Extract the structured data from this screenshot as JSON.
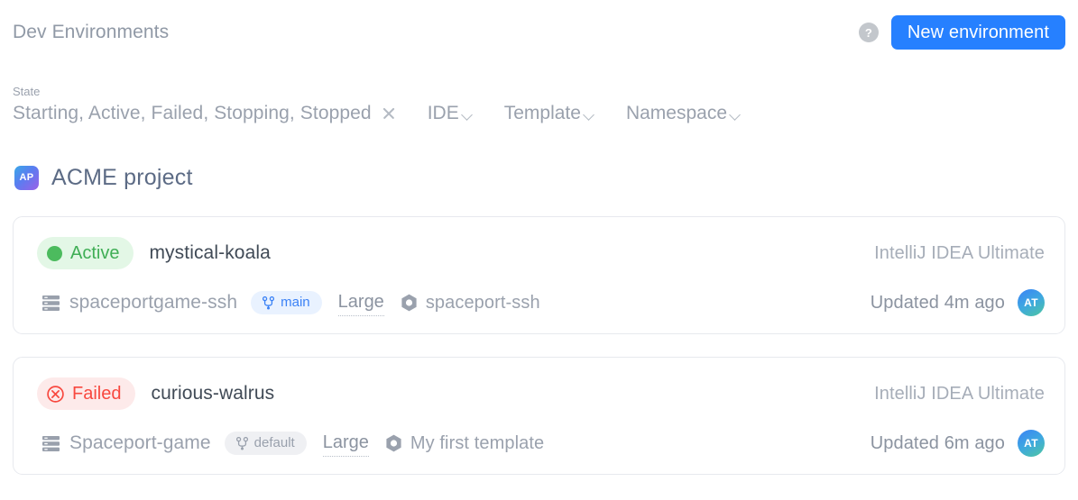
{
  "header": {
    "title": "Dev Environments",
    "help_icon": "question-mark-icon",
    "new_environment_label": "New environment"
  },
  "filters": {
    "state_label": "State",
    "state_value": "Starting, Active, Failed, Stopping, Stopped",
    "clear_icon": "close-x-icon",
    "dropdowns": [
      {
        "label": "IDE",
        "icon": "chevron-down-icon"
      },
      {
        "label": "Template",
        "icon": "chevron-down-icon"
      },
      {
        "label": "Namespace",
        "icon": "chevron-down-icon"
      }
    ]
  },
  "project": {
    "badge_initials": "AP",
    "name": "ACME project"
  },
  "environments": [
    {
      "status": {
        "label": "Active",
        "kind": "active",
        "icon": "green-dot-icon"
      },
      "name": "mystical-koala",
      "ide": "IntelliJ IDEA Ultimate",
      "repo_icon": "server-stack-icon",
      "repo": "spaceportgame-ssh",
      "branch": {
        "label": "main",
        "icon": "git-branch-icon",
        "tone": "blue"
      },
      "size": "Large",
      "template_icon": "hex-nut-icon",
      "template": "spaceport-ssh",
      "updated": "Updated 4m ago",
      "avatar_initials": "AT"
    },
    {
      "status": {
        "label": "Failed",
        "kind": "failed",
        "icon": "circle-x-icon"
      },
      "name": "curious-walrus",
      "ide": "IntelliJ IDEA Ultimate",
      "repo_icon": "server-stack-icon",
      "repo": "Spaceport-game",
      "branch": {
        "label": "default",
        "icon": "git-branch-icon",
        "tone": "gray"
      },
      "size": "Large",
      "template_icon": "hex-nut-icon",
      "template": "My first template",
      "updated": "Updated 6m ago",
      "avatar_initials": "AT"
    }
  ],
  "colors": {
    "accent_blue": "#2680ff",
    "active_green": "#3fae55",
    "failed_red": "#f8483f",
    "muted_text": "#9aa1ad",
    "card_border": "#e7e9ee"
  }
}
